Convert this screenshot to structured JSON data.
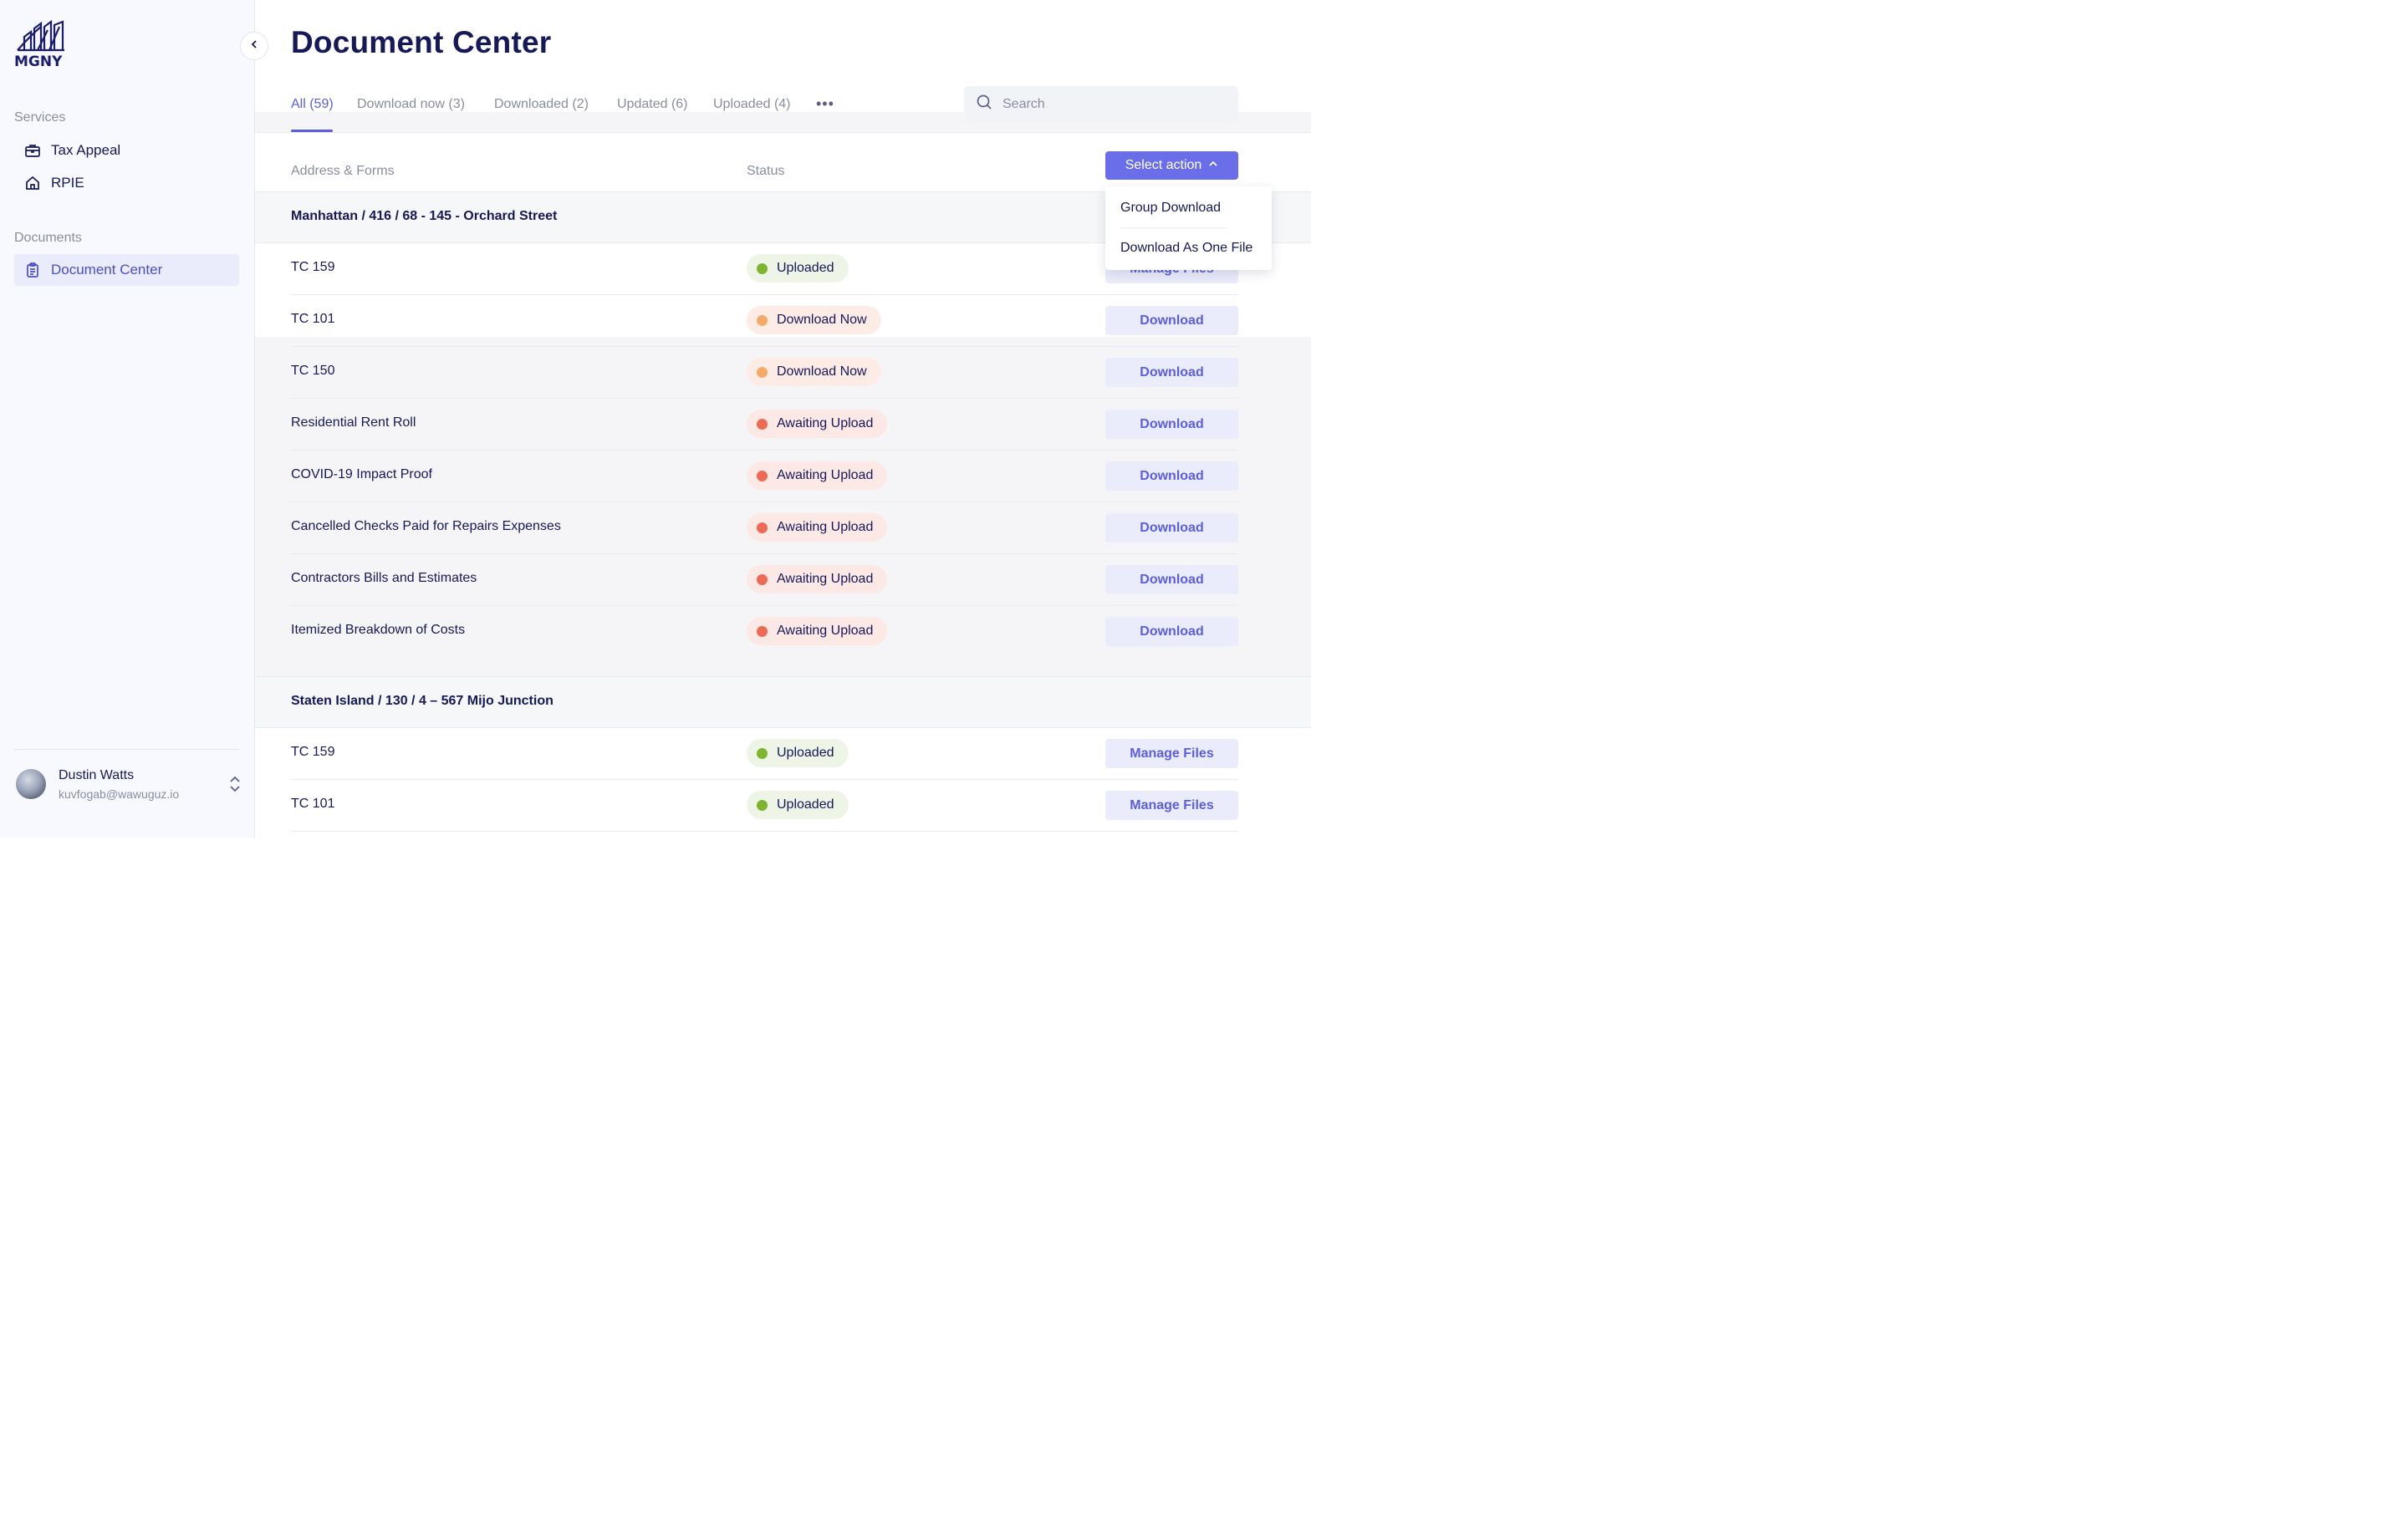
{
  "app": {
    "logo_text": "MGNY"
  },
  "sidebar": {
    "services_title": "Services",
    "services": [
      {
        "label": "Tax Appeal",
        "icon": "briefcase-icon"
      },
      {
        "label": "RPIE",
        "icon": "home-icon"
      }
    ],
    "documents_title": "Documents",
    "documents": [
      {
        "label": "Document Center",
        "icon": "clipboard-icon",
        "active": true
      }
    ],
    "user": {
      "name": "Dustin Watts",
      "email": "kuvfogab@wawuguz.io"
    }
  },
  "page": {
    "title": "Document Center"
  },
  "tabs": [
    {
      "label": "All (59)",
      "active": true
    },
    {
      "label": "Download now (3)"
    },
    {
      "label": "Downloaded (2)"
    },
    {
      "label": "Updated (6)"
    },
    {
      "label": "Uploaded (4)"
    }
  ],
  "tabs_more": "•••",
  "search": {
    "placeholder": "Search",
    "value": ""
  },
  "table": {
    "col_address": "Address & Forms",
    "col_status": "Status",
    "select_action": "Select action"
  },
  "dropdown": {
    "items": [
      "Group Download",
      "Download As One File"
    ]
  },
  "groups": [
    {
      "title": "Manhattan / 416 / 68 - 145 - Orchard Street",
      "rows": [
        {
          "name": "TC 159",
          "status": "Uploaded",
          "action": "Manage Files"
        },
        {
          "name": "TC 101",
          "status": "Download Now",
          "action": "Download"
        },
        {
          "name": "TC 150",
          "status": "Download Now",
          "action": "Download"
        },
        {
          "name": "Residential Rent Roll",
          "status": "Awaiting Upload",
          "action": "Download"
        },
        {
          "name": "COVID-19 Impact Proof",
          "status": "Awaiting Upload",
          "action": "Download"
        },
        {
          "name": "Cancelled Checks Paid for Repairs Expenses",
          "status": "Awaiting Upload",
          "action": "Download"
        },
        {
          "name": "Contractors Bills and Estimates",
          "status": "Awaiting Upload",
          "action": "Download"
        },
        {
          "name": "Itemized Breakdown of Costs",
          "status": "Awaiting Upload",
          "action": "Download"
        }
      ]
    },
    {
      "title": "Staten Island / 130 / 4 – 567 Mijo Junction",
      "rows": [
        {
          "name": "TC 159",
          "status": "Uploaded",
          "action": "Manage Files"
        },
        {
          "name": "TC 101",
          "status": "Uploaded",
          "action": "Manage Files"
        }
      ]
    }
  ],
  "colors": {
    "accent": "#5b5fdf",
    "uploaded": "#7fb52e",
    "download_now": "#f7a96a",
    "awaiting_upload": "#ef6a54"
  }
}
